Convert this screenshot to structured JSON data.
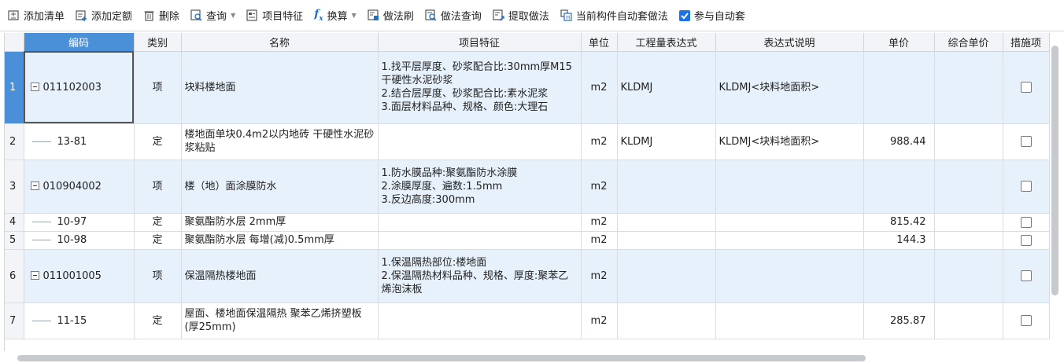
{
  "toolbar": {
    "add_list": "添加清单",
    "add_quota": "添加定额",
    "delete": "删除",
    "query": "查询",
    "item_feature": "项目特征",
    "convert": "换算",
    "method_brush": "做法刷",
    "method_query": "做法查询",
    "extract_method": "提取做法",
    "auto_apply_current": "当前构件自动套做法",
    "join_auto": "参与自动套",
    "join_auto_checked": true
  },
  "grid": {
    "headers": [
      "编码",
      "类别",
      "名称",
      "项目特征",
      "单位",
      "工程量表达式",
      "表达式说明",
      "单价",
      "综合单价",
      "措施项"
    ],
    "rows": [
      {
        "num": "1",
        "kind": "xiang",
        "code": "011102003",
        "type": "项",
        "name": "块料楼地面",
        "feature": "1.找平层厚度、砂浆配合比:30mm厚M15干硬性水泥砂浆\n2.结合层厚度、砂浆配合比:素水泥浆\n3.面层材料品种、规格、颜色:大理石",
        "unit": "m2",
        "expr": "KLDMJ",
        "expr_desc": "KLDMJ<块料地面积>",
        "price": "",
        "total_price": ""
      },
      {
        "num": "2",
        "kind": "ding",
        "code": "13-81",
        "type": "定",
        "name": "楼地面单块0.4m2以内地砖 干硬性水泥砂浆粘贴",
        "feature": "",
        "unit": "m2",
        "expr": "KLDMJ",
        "expr_desc": "KLDMJ<块料地面积>",
        "price": "988.44",
        "total_price": ""
      },
      {
        "num": "3",
        "kind": "xiang",
        "code": "010904002",
        "type": "项",
        "name": "楼（地）面涂膜防水",
        "feature": "1.防水膜品种:聚氨酯防水涂膜\n2.涂膜厚度、遍数:1.5mm\n3.反边高度:300mm",
        "unit": "m2",
        "expr": "",
        "expr_desc": "",
        "price": "",
        "total_price": ""
      },
      {
        "num": "4",
        "kind": "ding",
        "code": "10-97",
        "type": "定",
        "name": "聚氨酯防水层 2mm厚",
        "feature": "",
        "unit": "m2",
        "expr": "",
        "expr_desc": "",
        "price": "815.42",
        "total_price": ""
      },
      {
        "num": "5",
        "kind": "ding",
        "code": "10-98",
        "type": "定",
        "name": "聚氨酯防水层 每增(减)0.5mm厚",
        "feature": "",
        "unit": "m2",
        "expr": "",
        "expr_desc": "",
        "price": "144.3",
        "total_price": ""
      },
      {
        "num": "6",
        "kind": "xiang",
        "code": "011001005",
        "type": "项",
        "name": "保温隔热楼地面",
        "feature": "1.保温隔热部位:楼地面\n2.保温隔热材料品种、规格、厚度:聚苯乙烯泡沫板",
        "unit": "m2",
        "expr": "",
        "expr_desc": "",
        "price": "",
        "total_price": ""
      },
      {
        "num": "7",
        "kind": "ding",
        "code": "11-15",
        "type": "定",
        "name": "屋面、楼地面保温隔热 聚苯乙烯挤塑板(厚25mm)",
        "feature": "",
        "unit": "m2",
        "expr": "",
        "expr_desc": "",
        "price": "285.87",
        "total_price": ""
      }
    ]
  }
}
